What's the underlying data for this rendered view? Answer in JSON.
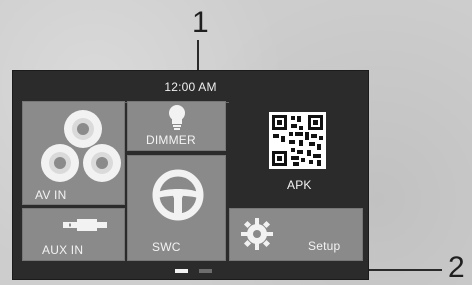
{
  "callouts": {
    "one": "1",
    "two": "2"
  },
  "header": {
    "time": "12:00 AM"
  },
  "tiles": {
    "av_in": "AV IN",
    "aux_in": "AUX IN",
    "dimmer": "DIMMER",
    "swc": "SWC",
    "apk": "APK",
    "setup": "Setup"
  },
  "page_indicator": {
    "current_page": 1,
    "total_pages": 2
  },
  "icons": {
    "av_in": "discs-icon",
    "aux_in": "aux-plug-icon",
    "dimmer": "bulb-icon",
    "swc": "steering-wheel-icon",
    "apk": "qr-code-icon",
    "setup": "gear-icon"
  },
  "colors": {
    "screen_bg": "#2b2b2b",
    "tile_bg": "#8a8a8a",
    "text": "#f3f3f3"
  }
}
